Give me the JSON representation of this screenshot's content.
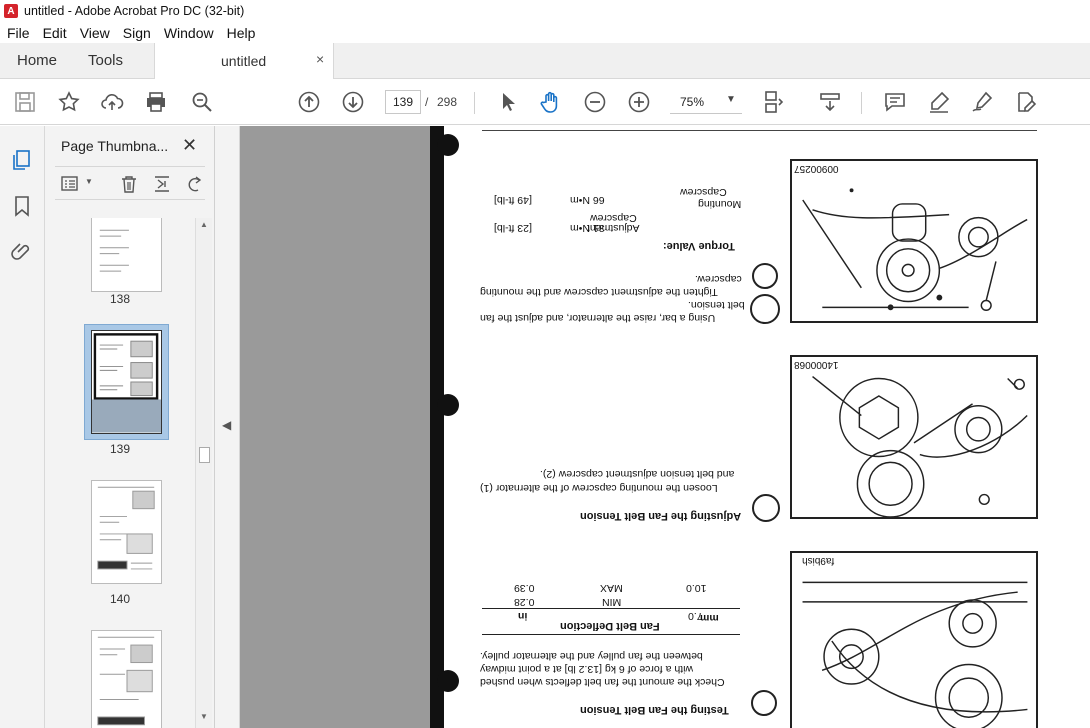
{
  "window": {
    "title": "untitled - Adobe Acrobat Pro DC (32-bit)"
  },
  "menu": [
    "File",
    "Edit",
    "View",
    "Sign",
    "Window",
    "Help"
  ],
  "nav_tabs": {
    "home": "Home",
    "tools": "Tools"
  },
  "document_tab": {
    "label": "untitled",
    "close": "×"
  },
  "toolbar": {
    "page_current": "139",
    "page_separator": "/",
    "page_total": "298",
    "zoom": "75%"
  },
  "sidebar": {
    "title": "Page Thumbna...",
    "close": "✕",
    "thumbnails": [
      {
        "label": "138"
      },
      {
        "label": "139",
        "selected": true
      },
      {
        "label": "140"
      },
      {
        "label": ""
      }
    ]
  },
  "page": {
    "sections": {
      "testing_title": "Testing the Fan Belt Tension",
      "testing_body": [
        "Check the amount the fan belt deflects when pushed",
        "with a force of 6 kg [13.2 lb] at a point midway",
        "between the fan pulley and the alternator pulley."
      ],
      "deflection_table": {
        "title": "Fan Belt Deflection",
        "headers": [
          "mm",
          "in"
        ],
        "rows": [
          [
            "7.0",
            "MIN",
            "0.28"
          ],
          [
            "10.0",
            "MAX",
            "0.39"
          ]
        ]
      },
      "adjusting_title": "Adjusting the Fan Belt Tension",
      "adjusting_body": [
        "Loosen the mounting capscrew of the alternator (1)",
        "and belt tension adjustment capscrew (2)."
      ],
      "raise_body": [
        "Using a bar, raise the alternator, and adjust the fan",
        "belt tension.",
        "Tighten the adjustment capscrew and the mounting",
        "capscrew."
      ],
      "torque": {
        "title": "Torque Value:",
        "rows": [
          {
            "name": [
              "Adjustment",
              "Capscrew"
            ],
            "nm": "31 N•m",
            "ftlb": "[23 ft-lb]"
          },
          {
            "name": [
              "Mounting",
              "Capscrew"
            ],
            "nm": "66 N•m",
            "ftlb": "[49 ft-lb]"
          }
        ]
      },
      "figures": [
        {
          "id": "00900257"
        },
        {
          "id": "14000068"
        },
        {
          "id": "fa9bish"
        }
      ]
    }
  }
}
